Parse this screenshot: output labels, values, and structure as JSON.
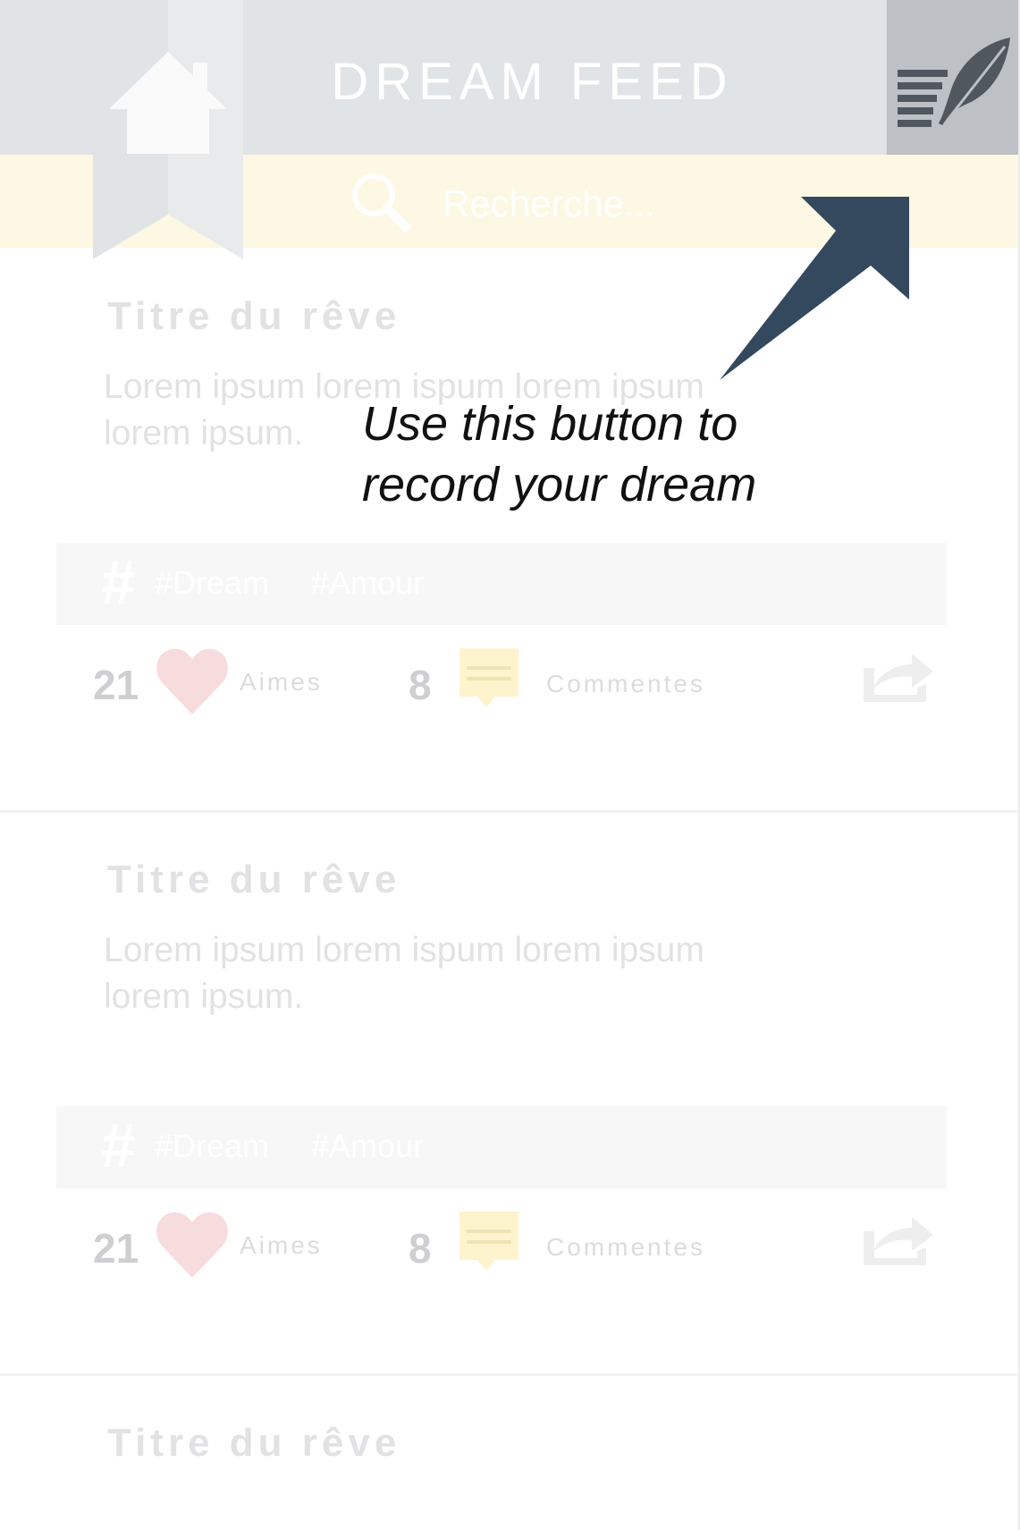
{
  "header": {
    "title": "DREAM FEED",
    "compose_icon": "compose-feather-icon"
  },
  "search": {
    "placeholder": "Recherche..."
  },
  "cards": [
    {
      "title": "Titre du rêve",
      "body": "Lorem ipsum lorem ispum lorem ipsum lorem ipsum.",
      "tags": [
        "#Dream",
        "#Amour"
      ],
      "likes": "21",
      "likes_label": "Aimes",
      "comments": "8",
      "comments_label": "Commentes"
    },
    {
      "title": "Titre du rêve",
      "body": "Lorem ipsum lorem ispum lorem ipsum lorem ipsum.",
      "tags": [
        "#Dream",
        "#Amour"
      ],
      "likes": "21",
      "likes_label": "Aimes",
      "comments": "8",
      "comments_label": "Commentes"
    },
    {
      "title": "Titre du rêve"
    }
  ],
  "tutorial": {
    "line1": "Use this button to",
    "line2": "record your dream"
  },
  "colors": {
    "header_bg": "#e1e4e6",
    "search_bg": "#fcf8e3",
    "accent_dark": "#34495e",
    "heart": "#f7dcdd",
    "comment": "#fdf4cd"
  }
}
